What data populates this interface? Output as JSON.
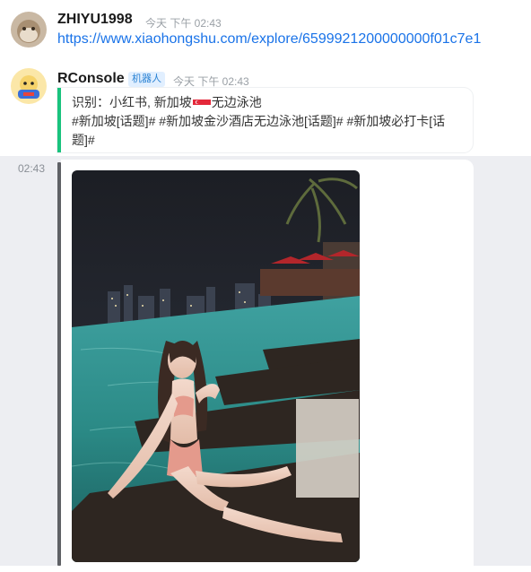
{
  "messages": [
    {
      "user": "ZHIYU1998",
      "time": "今天 下午 02:43",
      "link": "https://www.xiaohongshu.com/explore/6599921200000000f01c7e1"
    },
    {
      "user": "RConsole",
      "badge": "机器人",
      "time": "今天 下午 02:43",
      "line1_prefix": "识别：小红书, 新加坡",
      "line1_suffix": "无边泳池",
      "line2": "#新加坡[话题]# #新加坡金沙酒店无边泳池[话题]# #新加坡必打卡[话",
      "line3": "题]#"
    }
  ],
  "image_message": {
    "hover_time": "02:43"
  },
  "icons": [
    "avatar-zhiyu",
    "avatar-rconsole",
    "singapore-flag-emoji"
  ],
  "colors": {
    "link": "#1a73e8",
    "accent_bar": "#19c37d",
    "badge_bg": "#e1efff",
    "badge_text": "#2b83d3",
    "hover_bg": "#edeef2"
  }
}
